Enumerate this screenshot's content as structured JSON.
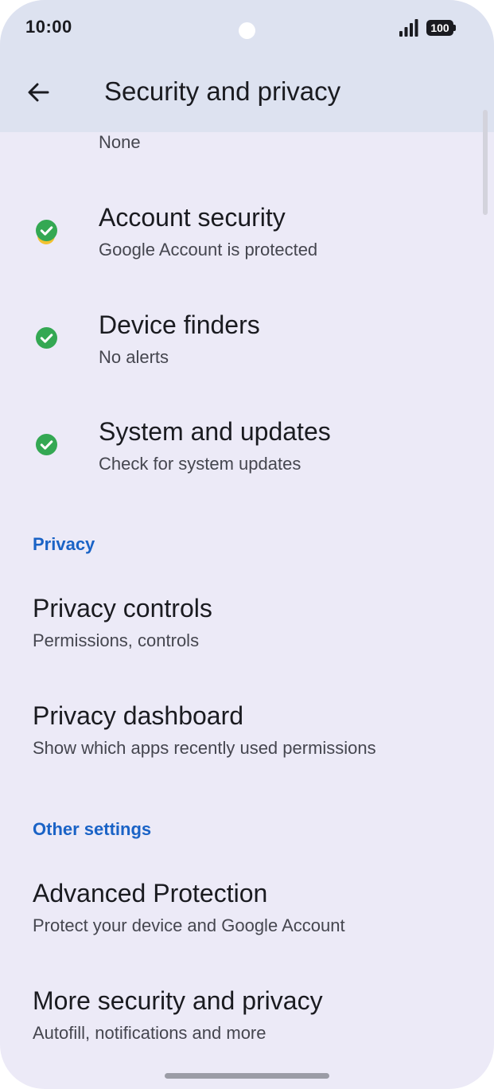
{
  "status_bar": {
    "time": "10:00",
    "battery": "100",
    "signal_icon": "signal-icon",
    "battery_icon": "battery-icon"
  },
  "app_bar": {
    "title": "Security and privacy",
    "back_icon": "arrow-back-icon"
  },
  "colors": {
    "background": "#eceaf7",
    "app_bar": "#dde2f0",
    "accent": "#1a63c6",
    "check_green": "#34a853"
  },
  "partial_item": {
    "subtitle": "None"
  },
  "security_items": [
    {
      "title": "Account security",
      "subtitle": "Google Account is protected",
      "status_icon": "check-circle-icon"
    },
    {
      "title": "Device finders",
      "subtitle": "No alerts",
      "status_icon": "check-circle-icon"
    },
    {
      "title": "System and updates",
      "subtitle": "Check for system updates",
      "status_icon": "check-circle-icon"
    }
  ],
  "privacy_section": {
    "header": "Privacy",
    "items": [
      {
        "title": "Privacy controls",
        "subtitle": "Permissions, controls"
      },
      {
        "title": "Privacy dashboard",
        "subtitle": "Show which apps recently used permissions"
      }
    ]
  },
  "other_section": {
    "header": "Other settings",
    "items": [
      {
        "title": "Advanced Protection",
        "subtitle": "Protect your device and Google Account"
      },
      {
        "title": "More security and privacy",
        "subtitle": "Autofill, notifications and more"
      }
    ]
  }
}
